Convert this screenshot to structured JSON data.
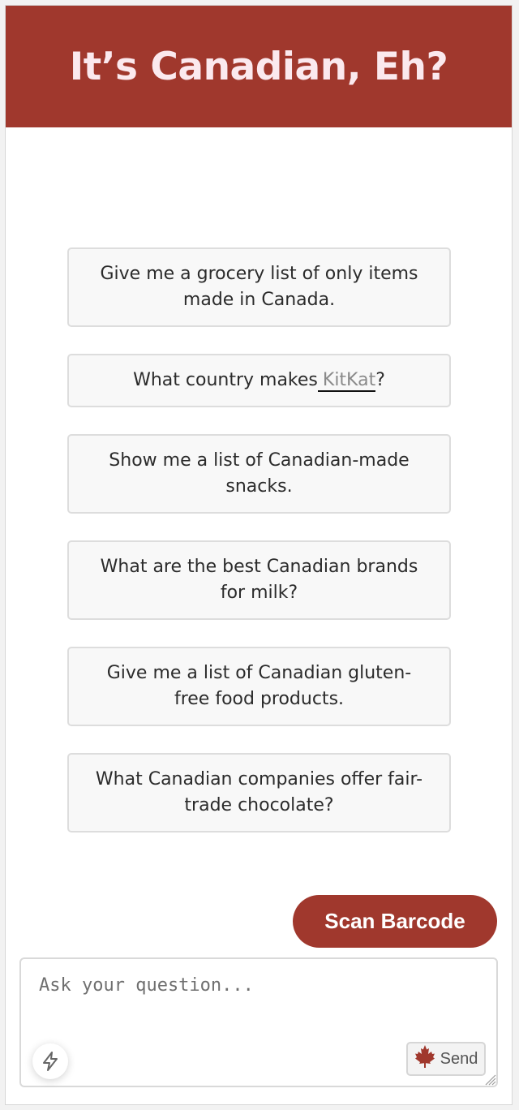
{
  "header": {
    "title": "It’s Canadian, Eh?"
  },
  "suggestions": [
    {
      "text": "Give me a grocery list of only items made in Canada."
    },
    {
      "prefix": "What country makes",
      "highlight": "KitKat",
      "suffix": "?"
    },
    {
      "text": "Show me a list of Canadian-made snacks."
    },
    {
      "text": "What are the best Canadian brands for milk?"
    },
    {
      "text": "Give me a list of Canadian gluten-free food products."
    },
    {
      "text": "What Canadian companies offer fair-trade chocolate?"
    }
  ],
  "actions": {
    "scan_label": "Scan Barcode"
  },
  "composer": {
    "placeholder": "Ask your question...",
    "send_label": "Send",
    "send_icon": "maple-leaf-icon",
    "quick_icon": "lightning-bolt-icon"
  },
  "colors": {
    "brand": "#a0382d",
    "title_text": "#fbe9ee",
    "card_bg": "#f8f8f8",
    "card_border": "#dddddd"
  }
}
